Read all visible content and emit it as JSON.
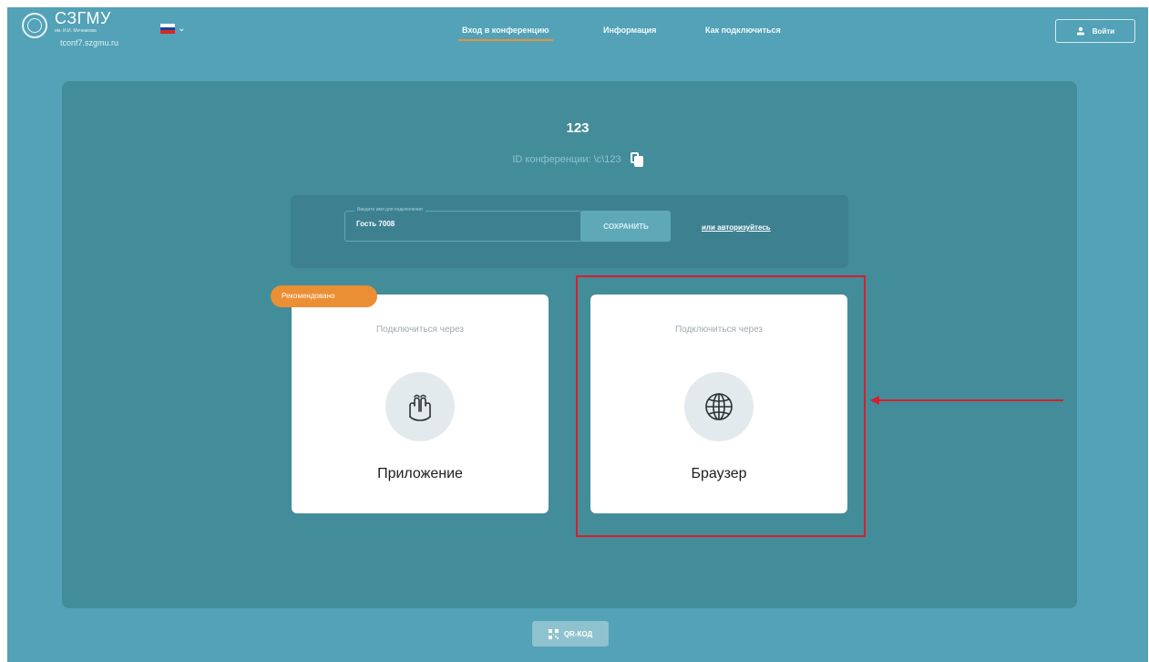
{
  "brand": {
    "name": "СЗГМУ",
    "subtitle": "им. И.И. Мечникова",
    "host": "tconf7.szgmu.ru"
  },
  "language": {
    "flag": "russia-flag-icon",
    "flag_colors": [
      "#ffffff",
      "#1c3fa3",
      "#d52b1e"
    ]
  },
  "nav": {
    "items": [
      {
        "label": "Вход в конференцию",
        "active": true
      },
      {
        "label": "Информация",
        "active": false
      },
      {
        "label": "Как подключиться",
        "active": false
      }
    ]
  },
  "login": {
    "label": "Войти",
    "icon": "user-icon"
  },
  "conference": {
    "title": "123",
    "id_label": "ID конференции: \\c\\123",
    "copy_icon": "copy-icon"
  },
  "name_form": {
    "field_label": "Введите имя для подключения",
    "value": "Гость 7008",
    "save_label": "СОХРАНИТЬ",
    "auth_link": "или авторизуйтесь"
  },
  "cards": [
    {
      "badge": "Рекомендовано",
      "subtitle": "Подключиться через",
      "title": "Приложение",
      "icon": "app-hands-icon"
    },
    {
      "subtitle": "Подключиться через",
      "title": "Браузер",
      "icon": "globe-icon"
    }
  ],
  "qr": {
    "label": "QR-КОД",
    "icon": "qr-code-icon"
  },
  "colors": {
    "background": "#53a2b7",
    "panel": "#438c9a",
    "accent": "#ea8f33",
    "highlight": "#d81f2a"
  }
}
